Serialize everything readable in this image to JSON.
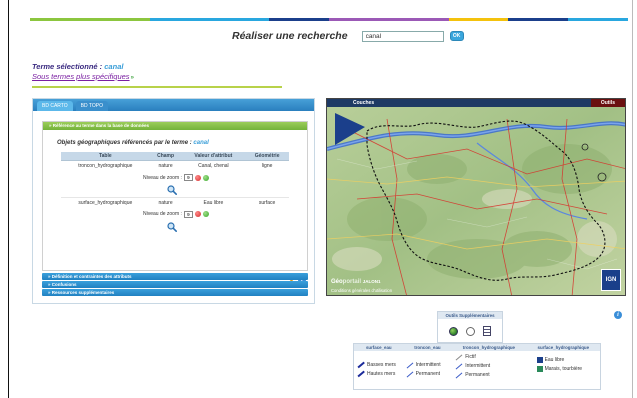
{
  "colors": {
    "top_bar": [
      "#8cc63f",
      "#8cc63f",
      "#29a7df",
      "#29a7df",
      "#1b3f8b",
      "#9b59b6",
      "#9b59b6",
      "#f4c20d",
      "#1b3f8b",
      "#29a7df"
    ],
    "accent_blue": "#3a9ed8",
    "accent_green": "#8cc63f"
  },
  "search": {
    "title": "Réaliser une recherche",
    "value": "canal",
    "ok_label": "OK"
  },
  "term": {
    "label": "Terme sélectionné :",
    "value": "canal",
    "subterms_link": "Sous termes plus spécifiques"
  },
  "tabs": [
    {
      "label": "BD CARTO",
      "active": true
    },
    {
      "label": "BD TOPO",
      "active": false
    }
  ],
  "section": {
    "header": "» Référence au terme dans la base de données",
    "objets_title": "Objets géographiques référencés par le terme :",
    "objets_term": "canal"
  },
  "table": {
    "headers": [
      "Table",
      "Champ",
      "Valeur d'attribut",
      "Géométrie"
    ],
    "rows": [
      {
        "table": "troncon_hydrographique",
        "champ": "nature",
        "valeur": "Canal, chenal",
        "geometrie": "ligne",
        "zoom_label": "Niveau de zoom :",
        "zoom_value": "9"
      },
      {
        "table": "surface_hydrographique",
        "champ": "nature",
        "valeur": "Eau libre",
        "geometrie": "surface",
        "zoom_label": "Niveau de zoom :",
        "zoom_value": "9"
      }
    ]
  },
  "collapsed_sections": [
    "» Définition et contraintes des attributs",
    "» Confusions",
    "» Ressources supplémentaires"
  ],
  "map": {
    "couches": "Couches",
    "outils": "Outils",
    "brand_left": "Géo",
    "brand_right": "portail",
    "brand_small": "JALON1",
    "credit": "Conditions générales d'utilisation",
    "ign": "IGN"
  },
  "outils_supp": {
    "title": "Outils Supplémentaires"
  },
  "legend": {
    "headers": [
      "surface_eau",
      "troncon_eau",
      "troncon_hydrographique",
      "surface_hydrographique"
    ],
    "col1": [
      {
        "label": "Basses mers",
        "color": "#1b2a9a"
      },
      {
        "label": "Hautes mers",
        "color": "#1b2a9a"
      }
    ],
    "col2": [
      {
        "label": "Intermittent",
        "color": "#3a5ac8"
      },
      {
        "label": "Permanent",
        "color": "#3a5ac8"
      }
    ],
    "col3": [
      {
        "label": "Fictif",
        "color": "#888888"
      },
      {
        "label": "Intermittent",
        "color": "#3a5ac8"
      },
      {
        "label": "Permanent",
        "color": "#3a5ac8"
      }
    ],
    "col4": [
      {
        "label": "Eau libre",
        "color": "#1b3f8b"
      },
      {
        "label": "Marais, tourbière",
        "color": "#2a8a5a"
      }
    ]
  }
}
